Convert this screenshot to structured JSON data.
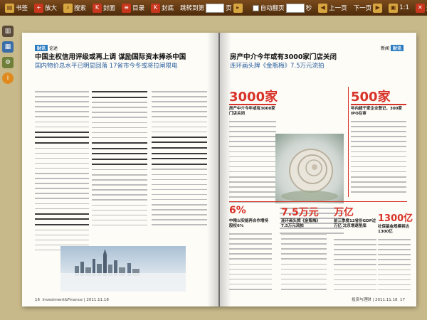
{
  "toolbar": {
    "bookmark": "书签",
    "zoom_in": "放大",
    "search": "搜索",
    "cover": "封面",
    "toc": "目录",
    "back_cover": "封底",
    "goto_page": "跳转到第",
    "page_unit": "页",
    "auto_flip": "自动翻页",
    "seconds": "秒",
    "prev_page": "上一页",
    "next_page": "下一页",
    "ratio": "1:1",
    "exit": "退出"
  },
  "left_page": {
    "section_tag": "财讯",
    "section_label": "论述",
    "headline": "中国主权信用评级或再上调 谋励国际资本捧杀中国",
    "subhead": "国内物价总水平已明显回落 17省市今冬或将拉闸限电",
    "page_number": "16",
    "footer_text": "Investment&Finance | 2011.11.18"
  },
  "right_page": {
    "section_tag": "财讯",
    "section_label": "新闻",
    "headline": "房产中介今年或有3000家门店关闭",
    "subhead": "连环画头牌《金瓶梅》7.5万元流拍",
    "big1": "3000家",
    "big1_caption": "房产中介今年或有3000家门店关闭",
    "big2": "500家",
    "big2_caption": "年内超千家企业登记，300家IPO在审",
    "big3": "6%",
    "big3_caption": "中粮以实能再合作增持股权6%",
    "big4": "7.5万元",
    "big4_caption": "连环画头牌《金瓶梅》7.5万元流拍",
    "big5": "万亿",
    "big5_caption": "前三季度12省份GDP过万亿 北京增速垫底",
    "big6": "1300亿",
    "big6_caption": "社保基金规模将达1300亿",
    "page_number": "17",
    "footer_text": "投资与理财 | 2011.11.18"
  },
  "dock": {
    "items": [
      "book-icon",
      "thumbnails-icon",
      "gear-icon",
      "info-icon"
    ]
  }
}
